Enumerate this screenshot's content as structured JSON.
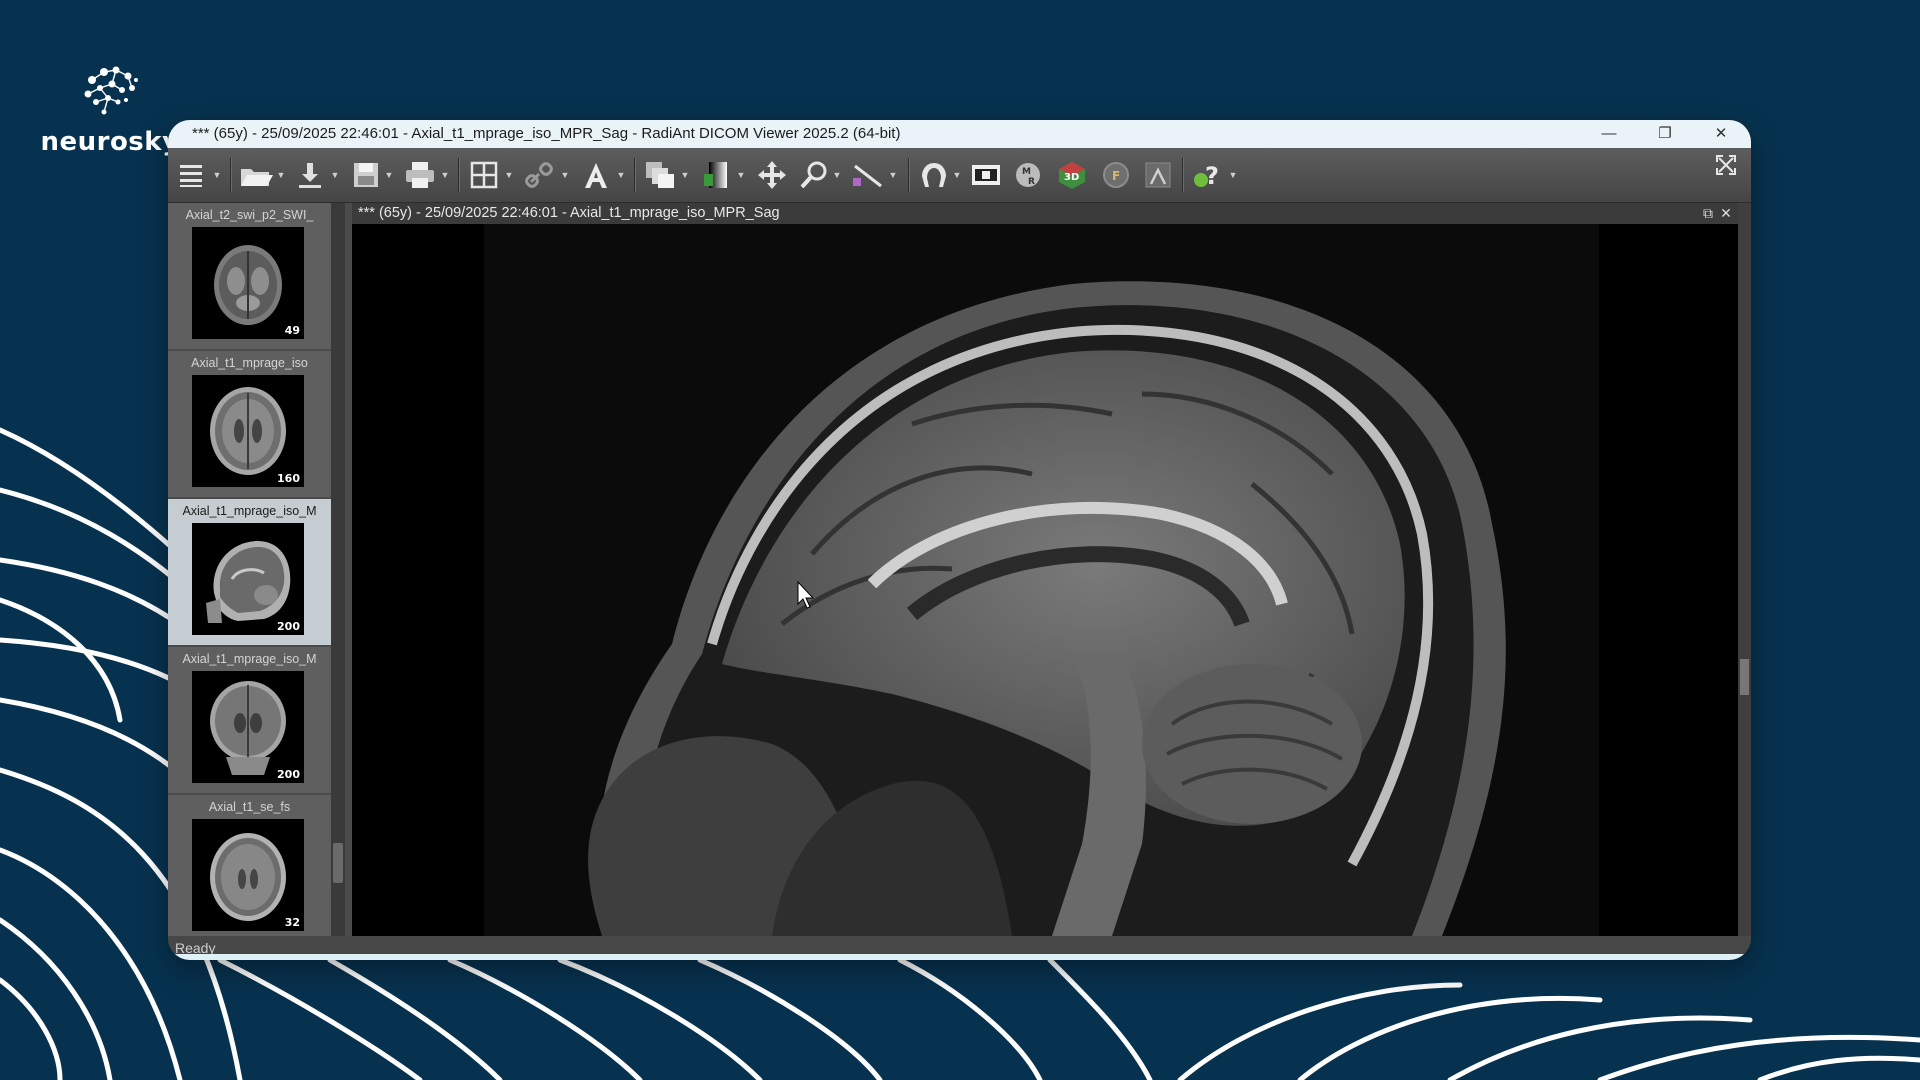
{
  "brand": {
    "name": "neurosky",
    "logo_icon": "brain-network-icon"
  },
  "window": {
    "title": "*** (65y) - 25/09/2025 22:46:01 - Axial_t1_mprage_iso_MPR_Sag - RadiAnt DICOM Viewer 2025.2 (64-bit)",
    "minimize": "—",
    "restore": "❐",
    "close": "✕"
  },
  "toolbar": {
    "buttons": [
      "menu-icon",
      "open-folder-icon",
      "download-icon",
      "save-icon",
      "print-icon",
      "layout-grid-icon",
      "link-icon",
      "text-annotation-icon",
      "series-stack-icon",
      "window-level-icon",
      "pan-icon",
      "zoom-icon",
      "measure-icon",
      "mpr-icon",
      "cine-icon",
      "mr-icon",
      "3d-icon",
      "fusion-icon",
      "tools-icon",
      "help-icon"
    ]
  },
  "series": [
    {
      "label": "Axial_t2_swi_p2_SWI_",
      "count": "49",
      "selected": false
    },
    {
      "label": "Axial_t1_mprage_iso",
      "count": "160",
      "selected": false
    },
    {
      "label": "Axial_t1_mprage_iso_M",
      "count": "200",
      "selected": true
    },
    {
      "label": "Axial_t1_mprage_iso_M",
      "count": "200",
      "selected": false
    },
    {
      "label": "Axial_t1_se_fs",
      "count": "32",
      "selected": false
    }
  ],
  "viewer": {
    "title": "*** (65y) - 25/09/2025 22:46:01 - Axial_t1_mprage_iso_MPR_Sag"
  },
  "status": {
    "text": "Ready"
  },
  "colors": {
    "background": "#07324f",
    "accent_line": "#ffffff",
    "window_chrome": "#4b4b4b"
  }
}
